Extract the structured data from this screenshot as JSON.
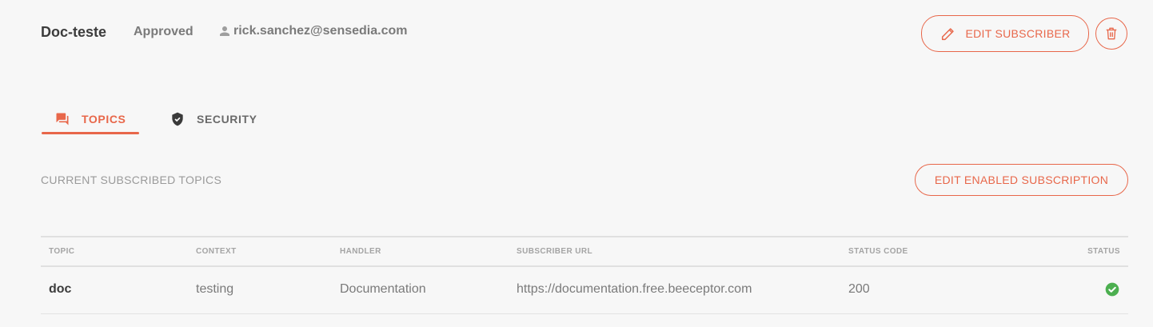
{
  "subscriber": {
    "name": "Doc-teste",
    "status": "Approved",
    "email": "rick.sanchez@sensedia.com"
  },
  "actions": {
    "edit_subscriber": "EDIT SUBSCRIBER",
    "edit_enabled_subscription": "EDIT ENABLED SUBSCRIPTION"
  },
  "tabs": [
    {
      "label": "TOPICS",
      "icon": "chat-icon",
      "active": true
    },
    {
      "label": "SECURITY",
      "icon": "shield-icon",
      "active": false
    }
  ],
  "section": {
    "title": "CURRENT SUBSCRIBED TOPICS"
  },
  "table": {
    "columns": [
      "TOPIC",
      "CONTEXT",
      "HANDLER",
      "SUBSCRIBER URL",
      "STATUS CODE",
      "STATUS"
    ],
    "rows": [
      {
        "topic": "doc",
        "context": "testing",
        "handler": "Documentation",
        "subscriber_url": "https://documentation.free.beeceptor.com",
        "status_code": "200",
        "status_icon": "check-circle-icon"
      }
    ]
  },
  "colors": {
    "accent": "#e8674a",
    "success": "#4caf50"
  }
}
